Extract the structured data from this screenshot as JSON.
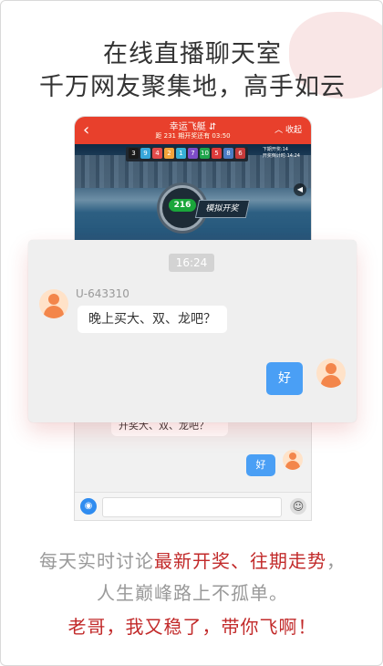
{
  "header": {
    "line1": "在线直播聊天室",
    "line2": "千万网友聚集地，高手如云"
  },
  "game": {
    "title": "幸运飞艇",
    "title_icon": "⇵",
    "issue": "距 231 期开奖还有 03:50",
    "collapse": "收起",
    "ball_colors": [
      "#1a1a1a",
      "#37a6d9",
      "#e34b4b",
      "#f3a33a",
      "#38b0d6",
      "#7e4cc7",
      "#1fa54c",
      "#dc3a3a",
      "#4b7cc4",
      "#c53a3a"
    ],
    "balls": [
      "3",
      "9",
      "4",
      "2",
      "1",
      "7",
      "10",
      "5",
      "8",
      "6"
    ],
    "next_label": "下期开奖",
    "next_value": "14",
    "countdown_label": "开奖倒计时",
    "countdown_value": "14:24",
    "result": "216",
    "sim_button": "模拟开奖"
  },
  "chat_bg": {
    "partial": "开奖大、双、龙吧？",
    "reply": "好"
  },
  "chat": {
    "time": "16:24",
    "user": "U-643310",
    "message": "晚上买大、双、龙吧？",
    "reply": "好"
  },
  "footer": {
    "l1_a": "每天实时讨论",
    "l1_b": "最新开奖",
    "l1_c": "、",
    "l1_d": "往期走势",
    "l1_e": "，",
    "l2": "人生巅峰路上不孤单。",
    "l3": "老哥，我又稳了，带你飞啊！"
  }
}
